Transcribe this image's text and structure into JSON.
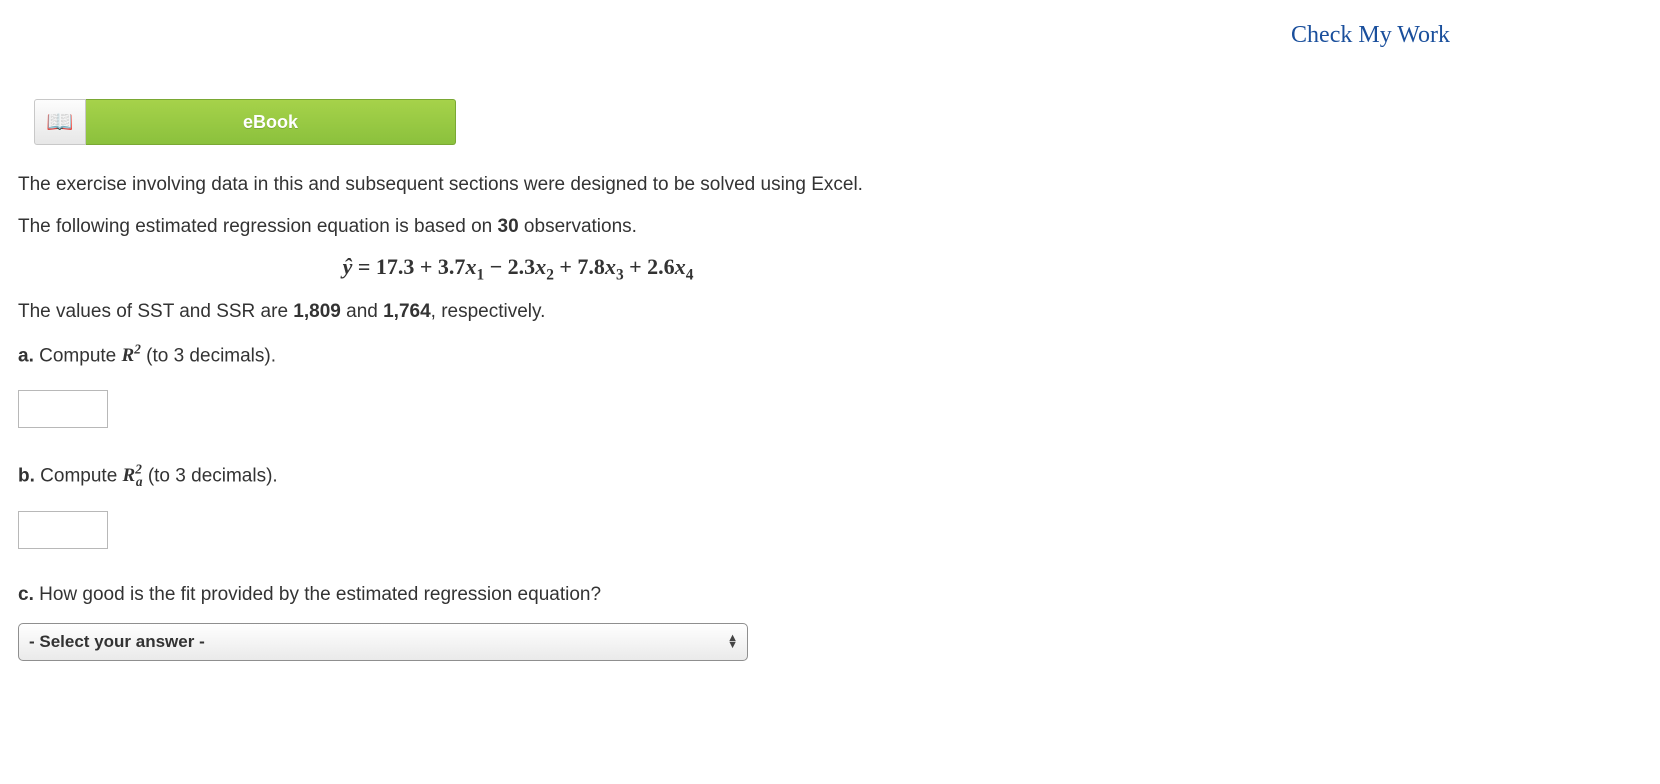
{
  "header": {
    "check_my_work": "Check My Work"
  },
  "ebook": {
    "label": "eBook",
    "icon": "📖"
  },
  "intro1": "The exercise involving data in this and subsequent sections were designed to be solved using Excel.",
  "intro2_pre": "The following estimated regression equation is based on ",
  "intro2_n": "30",
  "intro2_post": " observations.",
  "equation": "ŷ = 17.3 + 3.7x₁ − 2.3x₂ + 7.8x₃ + 2.6x₄",
  "sst_line_pre": "The values of SST and SSR are ",
  "sst_val": "1,809",
  "sst_mid": " and ",
  "ssr_val": "1,764",
  "sst_line_post": ", respectively.",
  "qa": {
    "label": "a.",
    "text_pre": " Compute ",
    "sym": "R",
    "sup": "2",
    "text_post": " (to 3 decimals)."
  },
  "qb": {
    "label": "b.",
    "text_pre": " Compute ",
    "sym": "R",
    "sup": "2",
    "sub": "a",
    "text_post": " (to 3 decimals)."
  },
  "qc": {
    "label": "c.",
    "text": " How good is the fit provided by the estimated regression equation?"
  },
  "select_placeholder": "- Select your answer -"
}
